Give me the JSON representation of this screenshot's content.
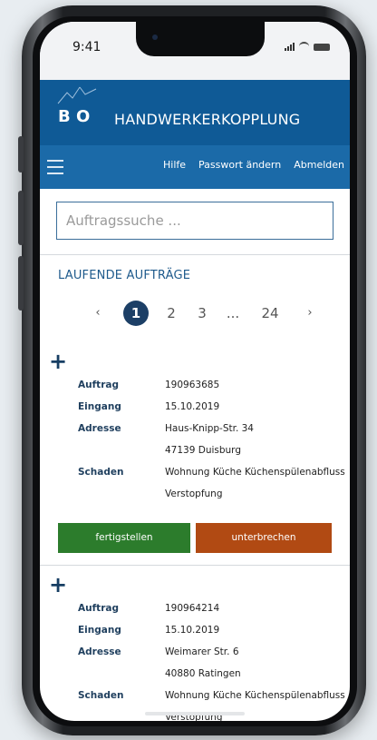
{
  "status_bar": {
    "time": "9:41"
  },
  "header": {
    "logo_text": "B O",
    "title": "HANDWERKERKOPPLUNG"
  },
  "nav": {
    "links": [
      "Hilfe",
      "Passwort ändern",
      "Abmelden"
    ]
  },
  "search": {
    "placeholder": "Auftragssuche ..."
  },
  "section": {
    "title": "LAUFENDE AUFTRÄGE"
  },
  "pagination": {
    "prev": "‹",
    "pages": [
      "1",
      "2",
      "3",
      "...",
      "24"
    ],
    "next": "›",
    "active": "1"
  },
  "labels": {
    "auftrag": "Auftrag",
    "eingang": "Eingang",
    "adresse": "Adresse",
    "schaden": "Schaden",
    "btn_finish": "fertigstellen",
    "btn_pause": "unterbrechen",
    "expand": "+"
  },
  "orders": [
    {
      "auftrag": "190963685",
      "eingang": "15.10.2019",
      "adresse_line1": "Haus-Knipp-Str. 34",
      "adresse_line2": "47139 Duisburg",
      "schaden_line1": "Wohnung Küche Küchenspülenabfluss",
      "schaden_line2": "Verstopfung"
    },
    {
      "auftrag": "190964214",
      "eingang": "15.10.2019",
      "adresse_line1": "Weimarer Str. 6",
      "adresse_line2": "40880 Ratingen",
      "schaden_line1": "Wohnung Küche Küchenspülenabfluss",
      "schaden_line2": "Verstopfung"
    }
  ],
  "colors": {
    "brand_blue": "#0f5a96",
    "nav_blue": "#1b6aa8",
    "button_green": "#2c7c2c",
    "button_red": "#b14a13"
  }
}
